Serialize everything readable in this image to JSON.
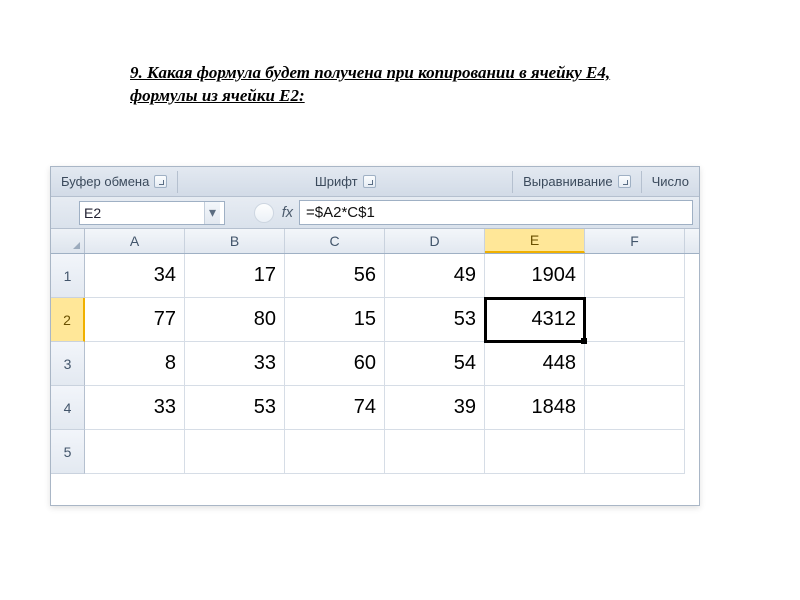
{
  "question": "9. Какая формула будет получена при копировании в ячейку E4, формулы из ячейки E2:",
  "ribbon": {
    "group1": "Буфер обмена",
    "group2": "Шрифт",
    "group3": "Выравнивание",
    "group4": "Число"
  },
  "name_box": "E2",
  "fx_label": "fx",
  "formula": "=$A2*C$1",
  "columns": [
    "A",
    "B",
    "C",
    "D",
    "E",
    "F"
  ],
  "active_col_index": 4,
  "active_row_index": 1,
  "rows": [
    {
      "h": "1",
      "cells": [
        "34",
        "17",
        "56",
        "49",
        "1904",
        ""
      ]
    },
    {
      "h": "2",
      "cells": [
        "77",
        "80",
        "15",
        "53",
        "4312",
        ""
      ]
    },
    {
      "h": "3",
      "cells": [
        "8",
        "33",
        "60",
        "54",
        "448",
        ""
      ]
    },
    {
      "h": "4",
      "cells": [
        "33",
        "53",
        "74",
        "39",
        "1848",
        ""
      ]
    },
    {
      "h": "5",
      "cells": [
        "",
        "",
        "",
        "",
        "",
        ""
      ]
    }
  ],
  "selected": {
    "row": 1,
    "col": 4
  }
}
